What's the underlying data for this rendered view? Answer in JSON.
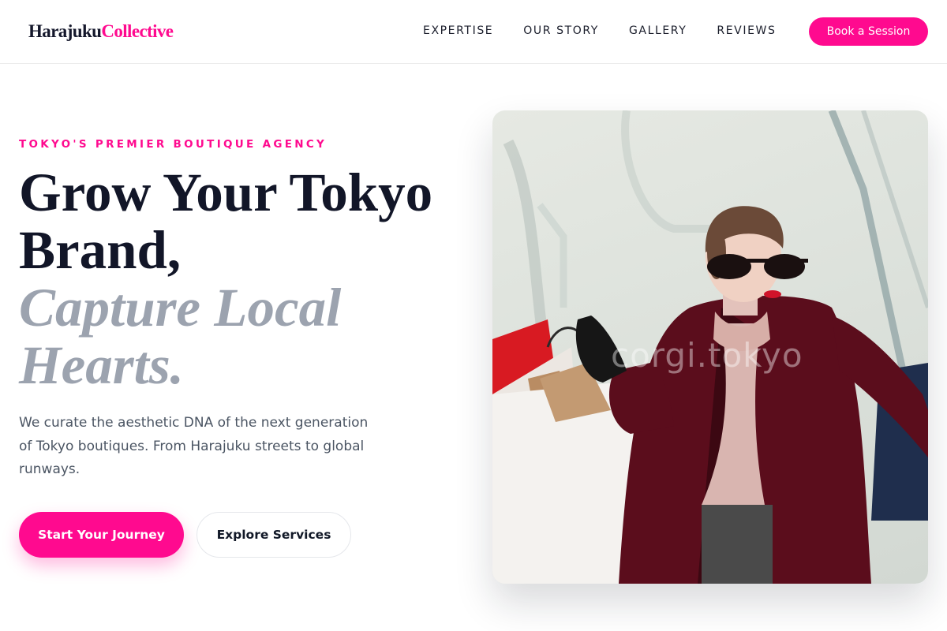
{
  "brand": {
    "part1": "Harajuku",
    "part2": "Collective",
    "accent_color": "#ff0a8f"
  },
  "nav": {
    "items": [
      {
        "label": "EXPERTISE"
      },
      {
        "label": "OUR STORY"
      },
      {
        "label": "GALLERY"
      },
      {
        "label": "REVIEWS"
      }
    ],
    "cta_label": "Book a Session"
  },
  "hero": {
    "eyebrow": "TOKYO'S PREMIER BOUTIQUE AGENCY",
    "headline_line1": "Grow Your Tokyo",
    "headline_line2": "Brand,",
    "headline_line3": "Capture Local",
    "headline_line4": "Hearts.",
    "description": "We curate the aesthetic DNA of the next generation of Tokyo boutiques. From Harajuku streets to global runways.",
    "primary_cta": "Start Your Journey",
    "secondary_cta": "Explore Services",
    "image_watermark": "corgi.tokyo"
  },
  "colors": {
    "primary": "#ff0a8f",
    "heading": "#121628",
    "muted_heading": "#9ca3af",
    "body_text": "#4b5563"
  }
}
